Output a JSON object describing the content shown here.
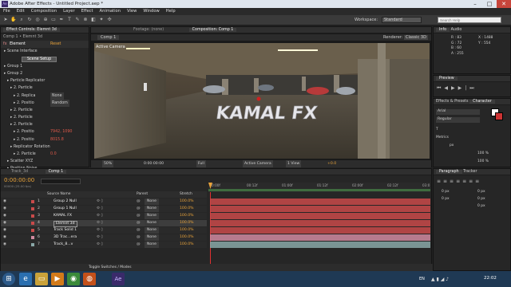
{
  "window": {
    "title": "Adobe After Effects - Untitled Project.aep *",
    "app_icon": "Ae"
  },
  "menu": [
    "File",
    "Edit",
    "Composition",
    "Layer",
    "Effect",
    "Animation",
    "View",
    "Window",
    "Help"
  ],
  "toolbar": {
    "workspace_label": "Workspace:",
    "workspace_value": "Standard",
    "search_placeholder": "Search Help"
  },
  "project_panel": {
    "tab": "Effect Controls: Elemnt 3d",
    "breadcrumb": "Comp 1 • Elemnt 3d",
    "effect_name": "Element",
    "reset_label": "Reset",
    "rows": [
      {
        "label": "Scene Interface",
        "value": ""
      },
      {
        "label": "Scene Setup",
        "value": ""
      },
      {
        "label": "Group 1",
        "value": ""
      },
      {
        "label": "Group 2",
        "value": ""
      },
      {
        "label": "Particle Replicator",
        "value": ""
      },
      {
        "label": "2. Particle",
        "value": ""
      },
      {
        "label": "2. Replica",
        "value": "None"
      },
      {
        "label": "2. Positio",
        "value": "Random"
      },
      {
        "label": "2. Particle",
        "value": ""
      },
      {
        "label": "2. Particle",
        "value": ""
      },
      {
        "label": "2. Particle",
        "value": ""
      },
      {
        "label": "2. Positio",
        "value": "7942, 1090"
      },
      {
        "label": "2. Positio",
        "value": "8015.8"
      },
      {
        "label": "Replicator Rotation",
        "value": ""
      },
      {
        "label": "2. Particle",
        "value": "0.0"
      },
      {
        "label": "Scatter XYZ",
        "value": ""
      },
      {
        "label": "Position Noise",
        "value": ""
      },
      {
        "label": "2. Random",
        "value": "1000"
      },
      {
        "label": "Particle Look",
        "value": ""
      }
    ]
  },
  "comp_panel": {
    "tab_footage": "Footage: (none)",
    "tab_comp": "Composition: Comp 1",
    "comp_label": "Comp 1",
    "renderer_label": "Renderer:",
    "renderer_value": "Classic 3D",
    "camera_label": "Active Camera",
    "title_text": "KAMAL FX",
    "footer": {
      "zoom": "50%",
      "timecode": "0:00:00:00",
      "resolution": "Full",
      "view": "Active Camera",
      "views": "1 View",
      "exposure": "+0.0"
    }
  },
  "info_panel": {
    "tabs": [
      "Info",
      "Audio"
    ],
    "r": "R : 83",
    "g": "G : 72",
    "b": "B : 60",
    "a": "A : 255",
    "x": "X : 1488",
    "y": "Y : 554"
  },
  "preview_panel": {
    "tab": "Preview"
  },
  "effects_panel": {
    "tabs": [
      "Effects & Presets",
      "Character"
    ],
    "font": "Arial",
    "style": "Regular",
    "size_unit": "px",
    "tracking": "100 %",
    "h_scale": "100 %",
    "metrics": "Metrics"
  },
  "paragraph_panel": {
    "tabs": [
      "Paragraph",
      "Tracker"
    ],
    "values": [
      "0 px",
      "0 px",
      "0 px",
      "0 px",
      "0 px"
    ]
  },
  "timeline": {
    "tabs": [
      "Track_3d",
      "Comp 1"
    ],
    "timecode": "0:00:00:00",
    "fps": "00000 (25.00 fps)",
    "search_placeholder": "",
    "col_source": "Source Name",
    "col_parent": "Parent",
    "col_stretch": "Stretch",
    "ruler": [
      "0:00f",
      "00:12f",
      "01:00f",
      "01:12f",
      "02:00f",
      "02:12f",
      "03:0"
    ],
    "layers": [
      {
        "num": "1",
        "name": "Group 2 Null",
        "parent": "None",
        "stretch": "100.0%",
        "color": "#c94a4a"
      },
      {
        "num": "2",
        "name": "Group 1 Null",
        "parent": "None",
        "stretch": "100.0%",
        "color": "#c94a4a"
      },
      {
        "num": "3",
        "name": "KAMAL FX",
        "parent": "None",
        "stretch": "100.0%",
        "color": "#c94a4a"
      },
      {
        "num": "4",
        "name": "Elemnt 3d",
        "parent": "None",
        "stretch": "100.0%",
        "color": "#c94a4a"
      },
      {
        "num": "5",
        "name": "Track Solid 1",
        "parent": "None",
        "stretch": "100.0%",
        "color": "#c94a4a"
      },
      {
        "num": "6",
        "name": "3D Trac...era",
        "parent": "None",
        "stretch": "100.0%",
        "color": "#d08aa0"
      },
      {
        "num": "7",
        "name": "Track_8...v",
        "parent": "None",
        "stretch": "100.0%",
        "color": "#8aa8a8"
      }
    ],
    "toggle_label": "Toggle Switches / Modes"
  },
  "taskbar": {
    "lang": "EN",
    "time": "22:02",
    "items": [
      "start",
      "ie",
      "explorer",
      "media",
      "chrome",
      "firefox",
      "ae"
    ]
  }
}
